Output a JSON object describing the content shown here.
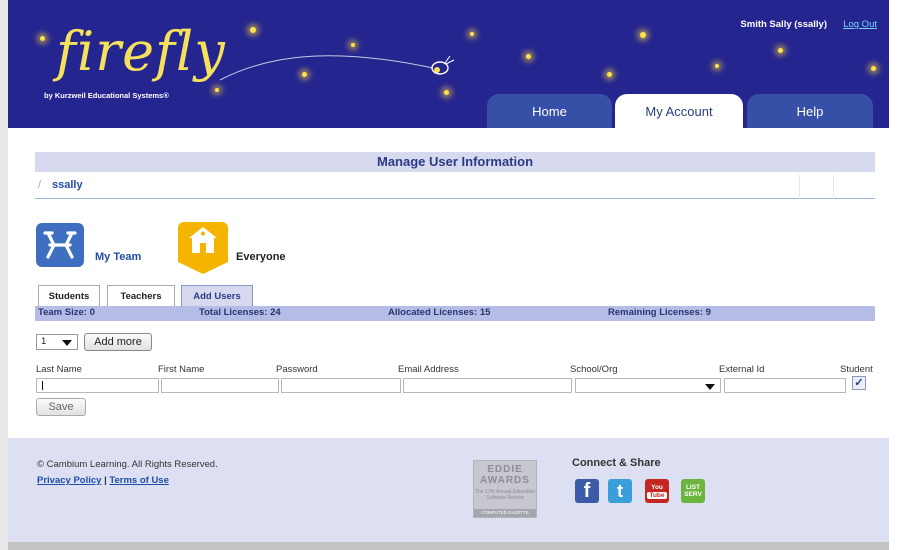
{
  "header": {
    "logo_text": "firefly",
    "logo_sub": "by Kurzweil Educational Systems®",
    "user_name": "Smith Sally (ssally)",
    "logout_label": "Log Out",
    "tabs": [
      {
        "label": "Home"
      },
      {
        "label": "My Account",
        "active": true
      },
      {
        "label": "Help"
      }
    ]
  },
  "page": {
    "title": "Manage User Information",
    "breadcrumb_sep": "/",
    "breadcrumb_user": "ssally"
  },
  "teams": {
    "my_team_label": "My Team",
    "everyone_label": "Everyone"
  },
  "subtabs": [
    {
      "label": "Students"
    },
    {
      "label": "Teachers"
    },
    {
      "label": "Add Users",
      "active": true
    }
  ],
  "stats": {
    "team_size": "Team Size: 0",
    "total": "Total Licenses: 24",
    "allocated": "Allocated Licenses: 15",
    "remaining": "Remaining Licenses: 9"
  },
  "add_form": {
    "count_value": "1",
    "add_more_label": "Add more",
    "columns": [
      "Last Name",
      "First Name",
      "Password",
      "Email Address",
      "School/Org",
      "External Id",
      "Student"
    ],
    "student_checked": true,
    "student_check_glyph": "✓",
    "save_label": "Save"
  },
  "footer": {
    "copyright": "© Cambium Learning. All Rights Reserved.",
    "privacy_label": "Privacy Policy",
    "link_sep": "|",
    "terms_label": "Terms of Use",
    "award": {
      "line1": "EDDIE",
      "line2": "AWARDS",
      "line3": "The 17th Annual Education Software Review",
      "line4": "COMPUTED GAZETTE"
    },
    "connect_title": "Connect & Share",
    "social": {
      "facebook": "f",
      "twitter": "t",
      "youtube_you": "You",
      "youtube_tube": "Tube",
      "listserv_1": "LIST",
      "listserv_2": "SERV"
    }
  },
  "colors": {
    "header_bg": "#25258f",
    "tab_bg": "#3550a6",
    "accent_link": "#1f4da8",
    "title_bar_bg": "#d7daef",
    "stats_bg": "#b5bde6",
    "footer_bg": "#dde0f2",
    "logo_yellow": "#f6e25a"
  },
  "icons": {
    "my_team": "team-chairs-icon",
    "everyone": "schoolhouse-icon",
    "dropdown": "chevron-down-icon",
    "logo_mark": "firefly-icon"
  }
}
